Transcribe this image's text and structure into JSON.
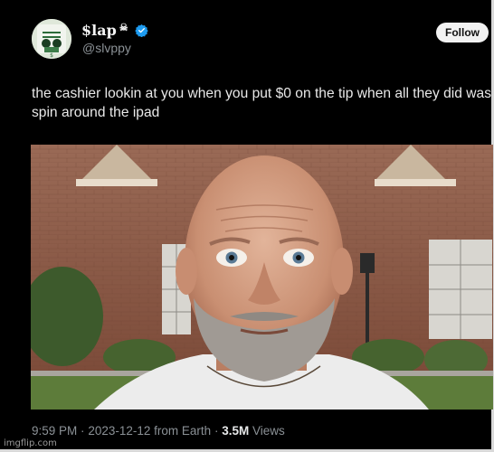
{
  "tweet": {
    "display_name": "$lap",
    "name_emoji": "☠",
    "handle": "@slvppy",
    "follow_label": "Follow",
    "text": "the cashier lookin at you when you put $0 on the tip when all they did was spin around the ipad",
    "meta": {
      "time": "9:59 PM",
      "date": "2023-12-12",
      "source": "from Earth",
      "views_count": "3.5M",
      "views_label": "Views"
    }
  },
  "icons": {
    "verified": "verified-badge-icon",
    "avatar": "profile-avatar"
  },
  "colors": {
    "background": "#000000",
    "follow_button": "#f2f2f2",
    "verified": "#1d9bf0",
    "muted_text": "#8b9196"
  },
  "watermark": "imgflip.com"
}
